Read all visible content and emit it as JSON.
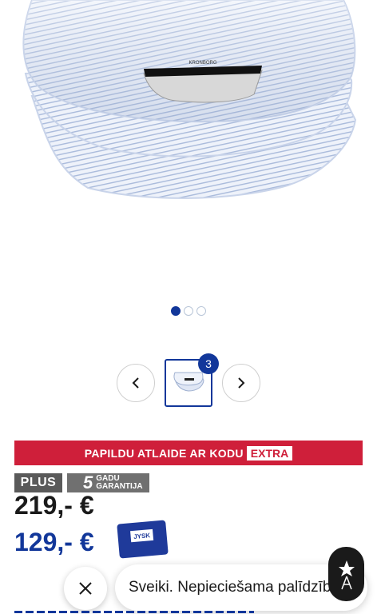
{
  "product_image": {
    "icon": "duvet-image",
    "label": "KRONBORG"
  },
  "carousel": {
    "total": 3,
    "active_index": 0
  },
  "gallery": {
    "prev_icon": "chevron-left-icon",
    "next_icon": "chevron-right-icon",
    "thumb_count": "3"
  },
  "promo": {
    "text": "PAPILDU ATLAIDE AR KODU",
    "code": "EXTRA"
  },
  "badges": {
    "plus": "PLUS",
    "warranty_number": "5",
    "warranty_line1": "GADU",
    "warranty_line2": "GARANTIJA"
  },
  "prices": {
    "regular": "219,-  €",
    "member": "129,-  €"
  },
  "card": {
    "logo": "JYSK"
  },
  "chat": {
    "close_icon": "close-icon",
    "message": "Sveiki. Nepieciešama palīdzība?",
    "avatar_icon": "chat-assistant-icon"
  },
  "colors": {
    "accent_blue": "#12379a",
    "promo_red": "#cf1f3a",
    "badge_gray": "#5a5a5a"
  }
}
